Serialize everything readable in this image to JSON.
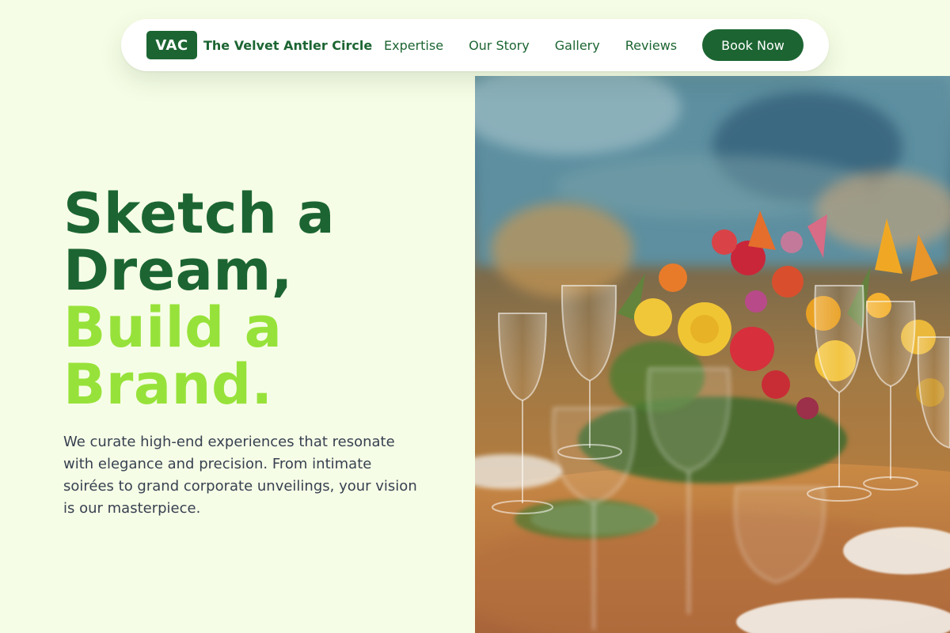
{
  "nav": {
    "logo_badge": "VAC",
    "brand_name": "The Velvet Antler Circle",
    "links": [
      {
        "label": "Expertise"
      },
      {
        "label": "Our Story"
      },
      {
        "label": "Gallery"
      },
      {
        "label": "Reviews"
      }
    ],
    "cta_label": "Book Now"
  },
  "hero": {
    "title_line1": "Sketch a",
    "title_line2": "Dream,",
    "title_line3": "Build a",
    "title_line4": "Brand.",
    "description": "We curate high-end experiences that resonate with elegance and precision. From intimate soirées to grand corporate unveilings, your vision is our masterpiece.",
    "image_subject": "banquet table with flower centerpiece and wine glasses"
  },
  "colors": {
    "background": "#f6fde6",
    "brand_dark": "#1c6532",
    "brand_light": "#97e23a",
    "text_body": "#374151",
    "nav_bg": "#ffffff"
  }
}
